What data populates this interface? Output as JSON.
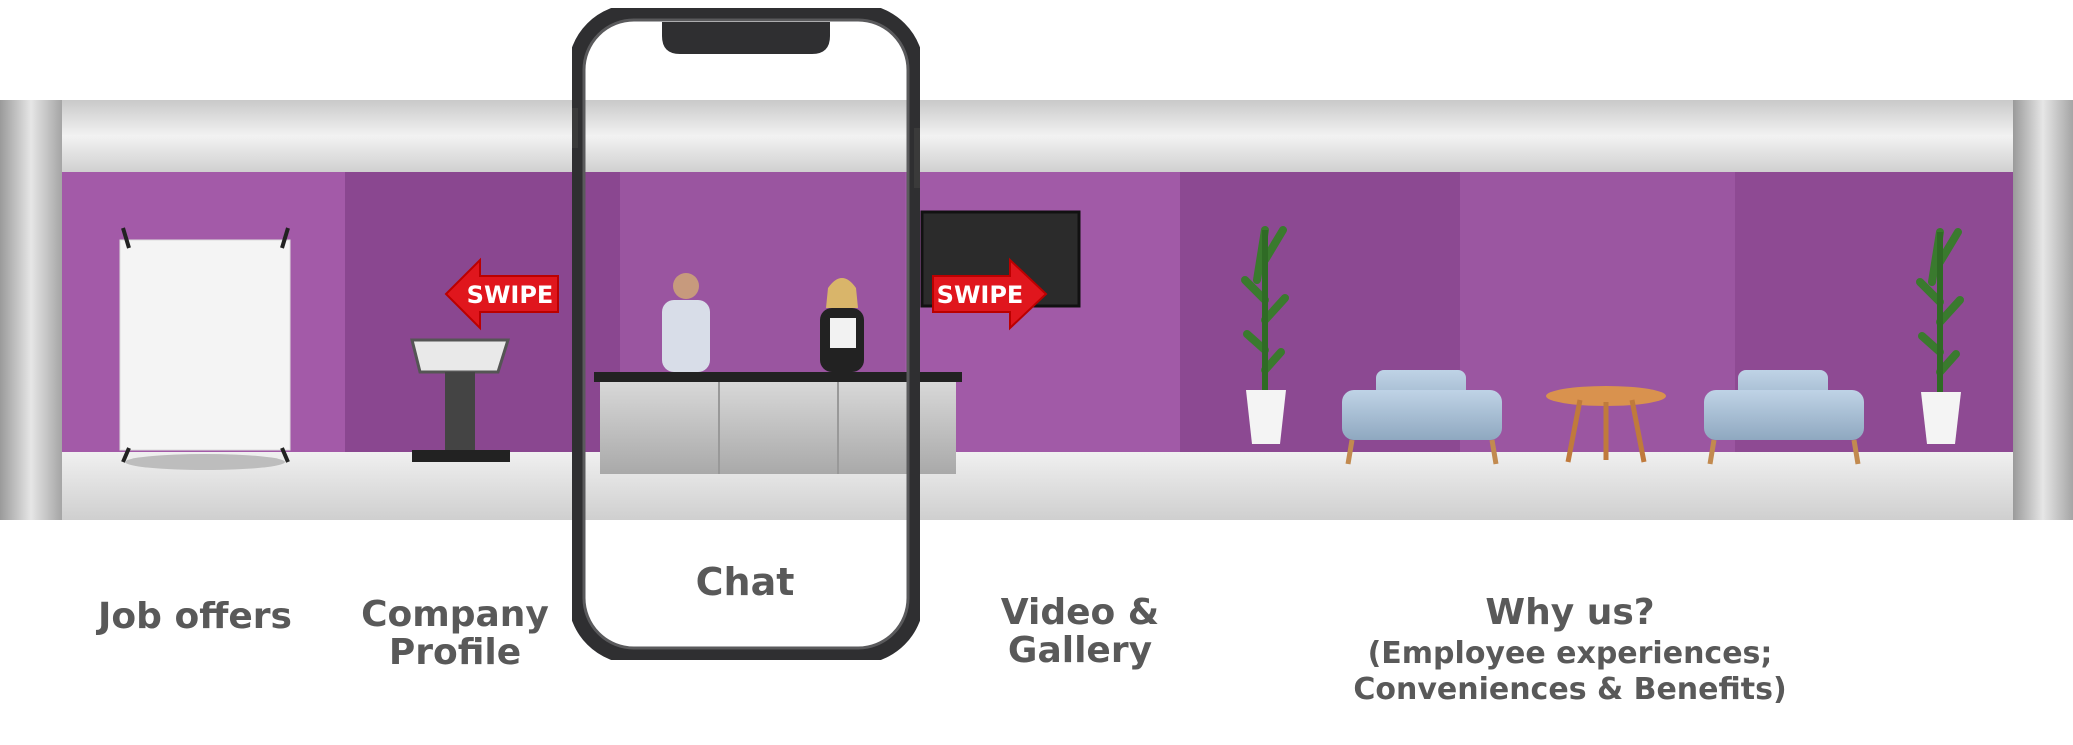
{
  "swipe": {
    "left_label": "SWIPE",
    "right_label": "SWIPE"
  },
  "phone": {
    "screen_label": "Chat"
  },
  "sections": {
    "job_offers": "Job offers",
    "company_profile": "Company Profile",
    "video_gallery": "Video & Gallery",
    "why_us_title": "Why us?",
    "why_us_sub": "(Employee experiences; Conveniences & Benefits)"
  },
  "colors": {
    "wall_purple": "#8e4a93",
    "wall_purple_light": "#a35aa8",
    "swipe_red": "#e0161d",
    "caption_gray": "#595959",
    "phone_frame": "#2f2f31"
  }
}
